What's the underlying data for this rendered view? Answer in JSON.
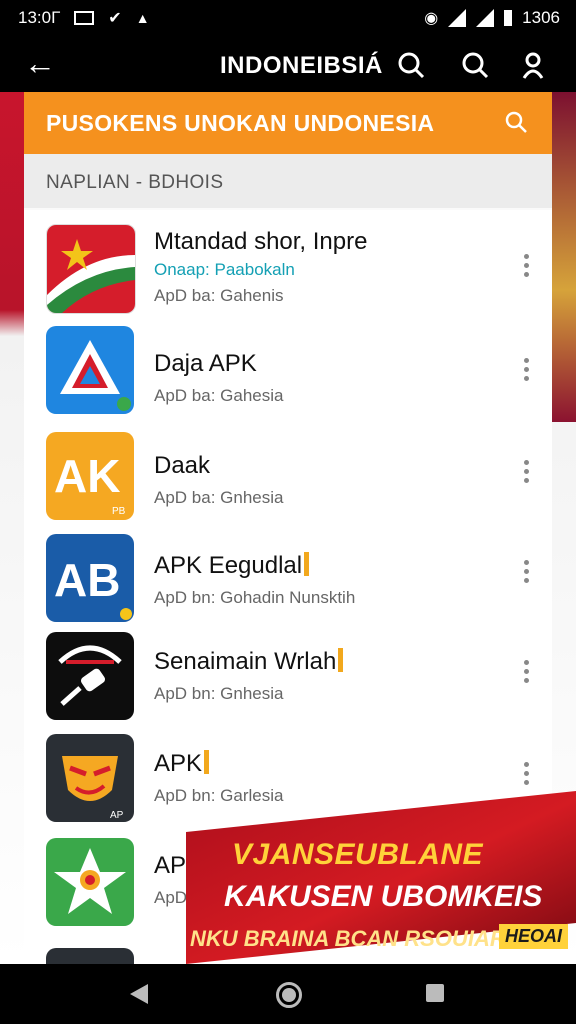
{
  "status_bar": {
    "time": "13:0Г",
    "icons": [
      "mail-icon",
      "check-icon",
      "alert-icon"
    ],
    "battery": "1306"
  },
  "app_bar": {
    "title": "INDONEIBSIÁ"
  },
  "search_banner": {
    "text": "PUSOKENS UNOKAN UNDONESIA"
  },
  "section": {
    "header": "NAPLIAN - BDHOIS"
  },
  "apps": [
    {
      "name": "Mtandad shor, Inpre",
      "subtitle": "Onaap: Paabokaln",
      "developer": "ApD ba: Gahenis",
      "icon": "flag-star-app-icon",
      "color": "#d51d2b"
    },
    {
      "name": "Daja APK",
      "subtitle": "",
      "developer": "ApD ba: Gahesia",
      "icon": "triangle-a-app-icon",
      "color": "#1f86e0"
    },
    {
      "name": "Daak",
      "subtitle": "",
      "developer": "ApD ba: Gnhesia",
      "icon": "ak-app-icon",
      "color": "#f5a822"
    },
    {
      "name": "APK Eegudlal",
      "subtitle": "",
      "developer": "ApD bn: Gohadin Nunsktih",
      "icon": "ab-app-icon",
      "color": "#1a5ca8"
    },
    {
      "name": "Senaimain Wrlah",
      "subtitle": "",
      "developer": "ApD bn: Gnhesia",
      "icon": "key-app-icon",
      "color": "#111111"
    },
    {
      "name": "APK",
      "subtitle": "",
      "developer": "ApD bn: Garlesia",
      "icon": "shield-face-app-icon",
      "color": "#2a2f35"
    },
    {
      "name": "APK",
      "subtitle": "",
      "developer": "ApD",
      "icon": "star-emblem-app-icon",
      "color": "#3aa84a"
    }
  ],
  "promo": {
    "line1": "VJANSEUBLANE",
    "line2": "KAKUSEN UBOMKEIS",
    "line3": "NKU BRAINA BCAN RSOUIAR!",
    "tag": "HEOAI"
  }
}
